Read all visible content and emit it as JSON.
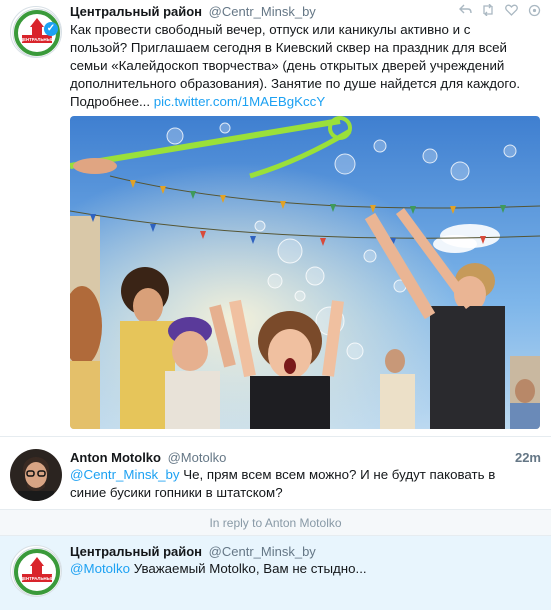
{
  "tweets": [
    {
      "name": "Центральный район",
      "handle": "@Centr_Minsk_by",
      "lines": [
        "Как провести свободный вечер, отпуск или каникулы активно и с",
        "пользой? Приглашаем сегодня в Киевский сквер на праздник для всей",
        "семьи «Калейдоскоп творчества» (день открытых дверей учреждений",
        "дополнительного образования). Занятие по душе найдется для каждого."
      ],
      "more_label": "Подробнее...",
      "link": "pic.twitter.com/1MAEBgKccY",
      "logo_text": "ЦЕНТРАЛЬНЫЙ"
    },
    {
      "name": "Anton Motolko",
      "handle": "@Motolko",
      "time": "22m",
      "mention": "@Centr_Minsk_by",
      "text_line1": " Че, прям всем всем можно? И не будут паковать в",
      "text_line2": "синие бусики гопники в штатском?"
    },
    {
      "name": "Центральный район",
      "handle": "@Centr_Minsk_by",
      "mention": "@Motolko",
      "text": " Уважаемый Motolko, Вам не стыдно...",
      "logo_text": "ЦЕНТРАЛЬНЫЙ"
    }
  ],
  "reply_bar": "In reply to Anton Motolko",
  "icons": {
    "actions": [
      "reply-icon",
      "retweet-icon",
      "like-icon",
      "more-icon"
    ],
    "verified": "verified-badge-icon"
  },
  "colors": {
    "link": "#1da1f2",
    "highlight": "#e8f5fd",
    "handle": "#657786"
  }
}
